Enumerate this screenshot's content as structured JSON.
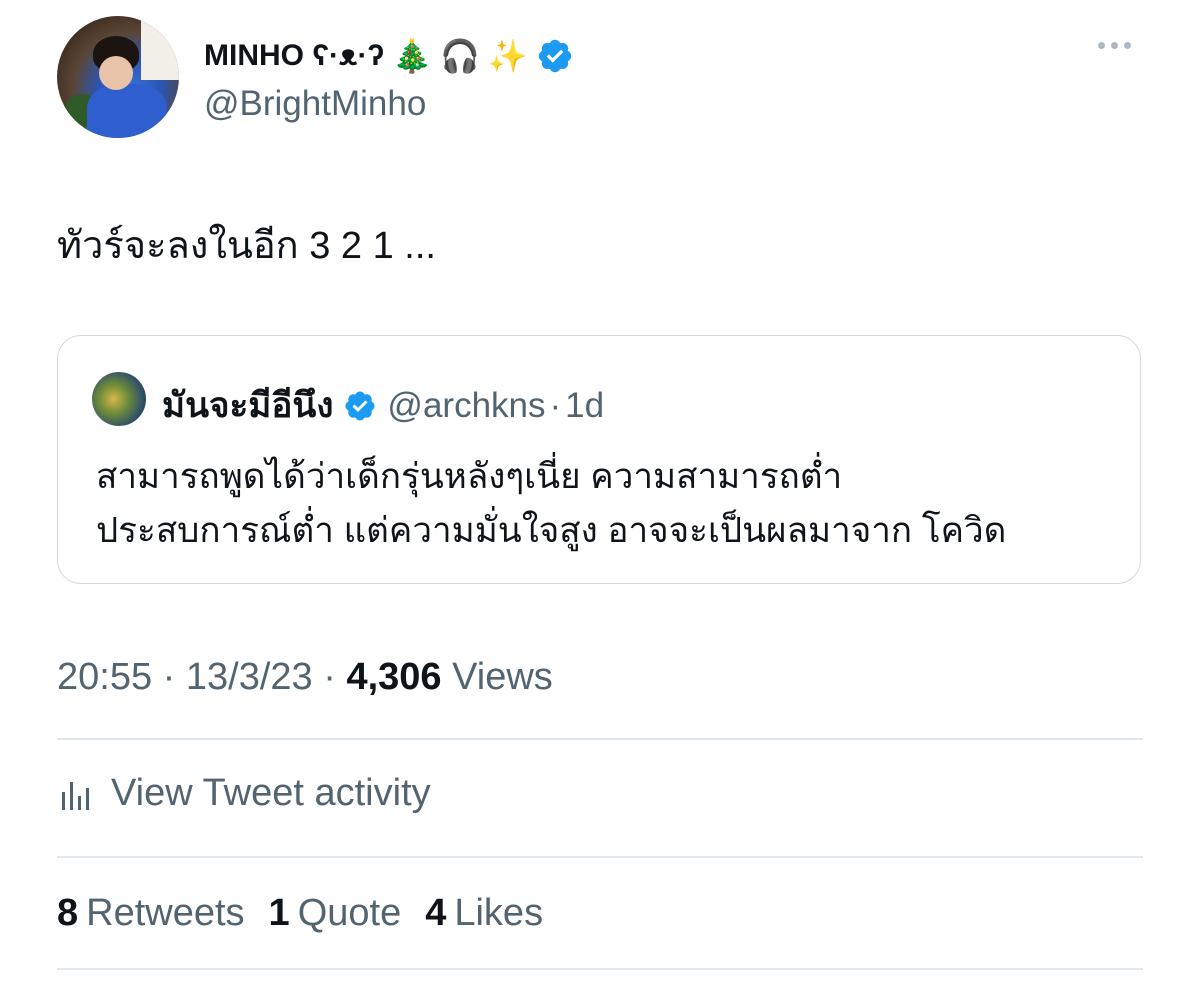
{
  "author": {
    "display_name": "MINHO ʕ·ᴥ·ʔ",
    "emojis": [
      "🎄",
      "🎧",
      "✨"
    ],
    "handle": "@BrightMinho",
    "verified": true,
    "avatar_icon": "profile-photo"
  },
  "tweet": {
    "text": "ทัวร์จะลงในอีก 3 2 1 ..."
  },
  "quote": {
    "display_name": "มันจะมีอีนึง",
    "handle": "@archkns",
    "separator": "·",
    "age": "1d",
    "verified": true,
    "text_lines": [
      "สามารถพูดได้ว่าเด็กรุ่นหลังๆเนี่ย ความสามารถต่ำ",
      "ประสบการณ์ต่ำ แต่ความมั่นใจสูง อาจจะเป็นผลมาจาก โควิด"
    ]
  },
  "meta": {
    "time": "20:55",
    "sep1": " · ",
    "date": "13/3/23",
    "sep2": " · ",
    "views_count": "4,306",
    "views_label": "Views"
  },
  "activity": {
    "label": "View Tweet activity",
    "icon": "bar-chart-icon"
  },
  "stats": {
    "retweets_count": "8",
    "retweets_label": "Retweets",
    "quotes_count": "1",
    "quotes_label": "Quote",
    "likes_count": "4",
    "likes_label": "Likes"
  },
  "colors": {
    "verified_blue": "#1d9bf0",
    "secondary_text": "#536471",
    "primary_text": "#0f1419",
    "border": "#cfd9de"
  }
}
